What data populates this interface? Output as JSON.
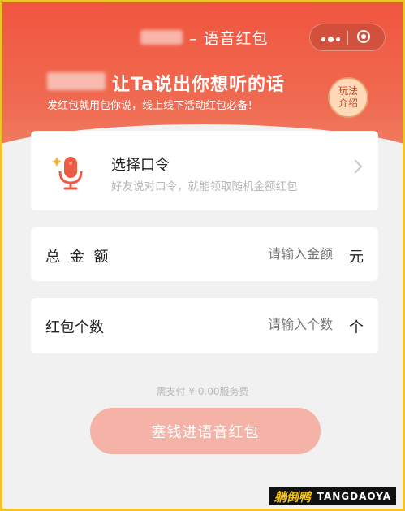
{
  "header": {
    "title_suffix": "– 语音红包",
    "headline": "让Ta说出你想听的话",
    "subline": "发红包就用包你说，线上线下活动红包必备！",
    "badge_lines": [
      "玩法",
      "介绍"
    ],
    "colors": {
      "accent": "#f1553f",
      "badge_bg": "#ffd9b8"
    }
  },
  "capsule": {
    "more_icon": "more-dots-icon",
    "close_icon": "target-icon"
  },
  "voice_card": {
    "title": "选择口令",
    "subtitle": "好友说对口令，就能领取随机金额红包",
    "icon": "microphone-icon"
  },
  "amount_row": {
    "label": "总 金 额",
    "placeholder": "请输入金额",
    "unit": "元"
  },
  "count_row": {
    "label": "红包个数",
    "placeholder": "请输入个数",
    "unit": "个"
  },
  "fee_text": "需支付 ¥ 0.00服务费",
  "submit_label": "塞钱进语音红包",
  "watermark": {
    "cn": "躺倒鸭",
    "en": "TANGDAOYA"
  }
}
